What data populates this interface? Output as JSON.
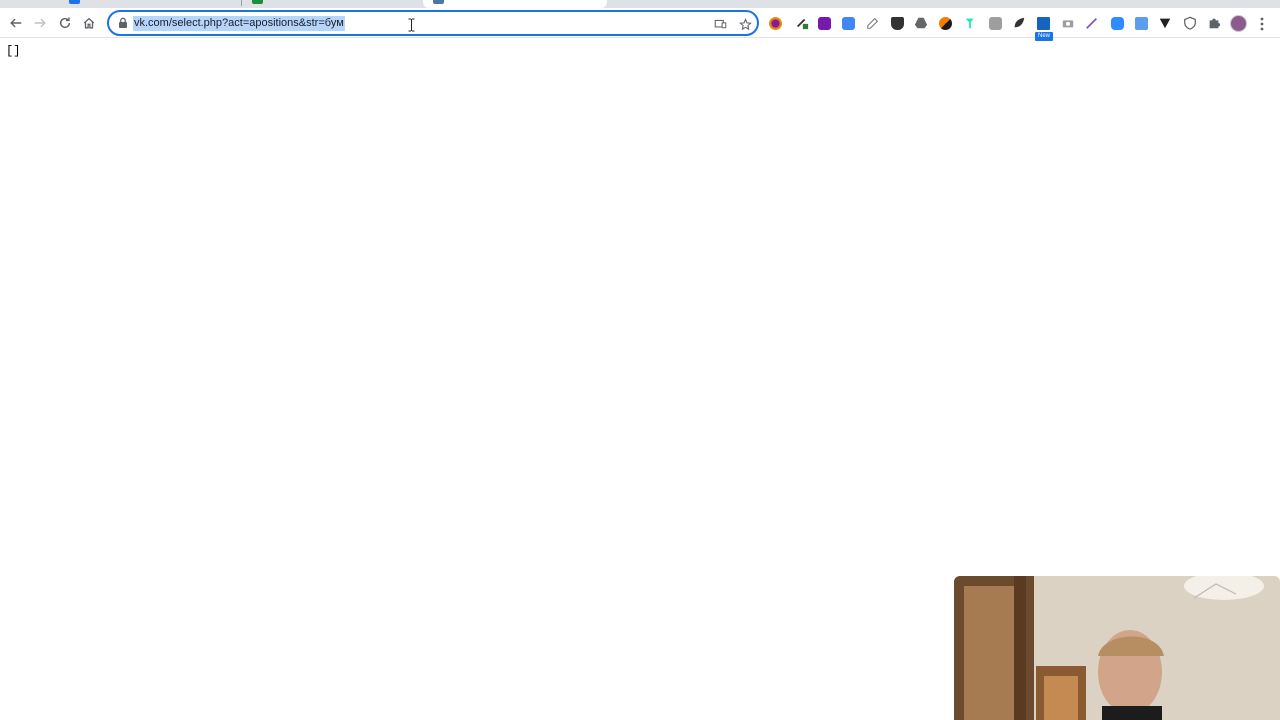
{
  "browser": {
    "address_bar": {
      "url": "vk.com/select.php?act=apositions&str=бум"
    },
    "extensions": [
      "color-picker-icon",
      "puzzle-green-icon",
      "onenote-icon",
      "translate-icon",
      "notes-icon",
      "shield-key-icon",
      "drive-icon",
      "analytics-icon",
      "pin-icon",
      "code-icon",
      "leaf-icon",
      "new-extension-icon",
      "camera-icon",
      "pen-icon",
      "zoom-icon",
      "reader-icon",
      "location-icon",
      "vpn-shield-icon",
      "extensions-puzzle-icon"
    ],
    "new_badge_label": "New"
  },
  "page": {
    "body_text": "[]"
  },
  "colors": {
    "accent": "#1a73e8",
    "selection": "#b4d5fe"
  }
}
